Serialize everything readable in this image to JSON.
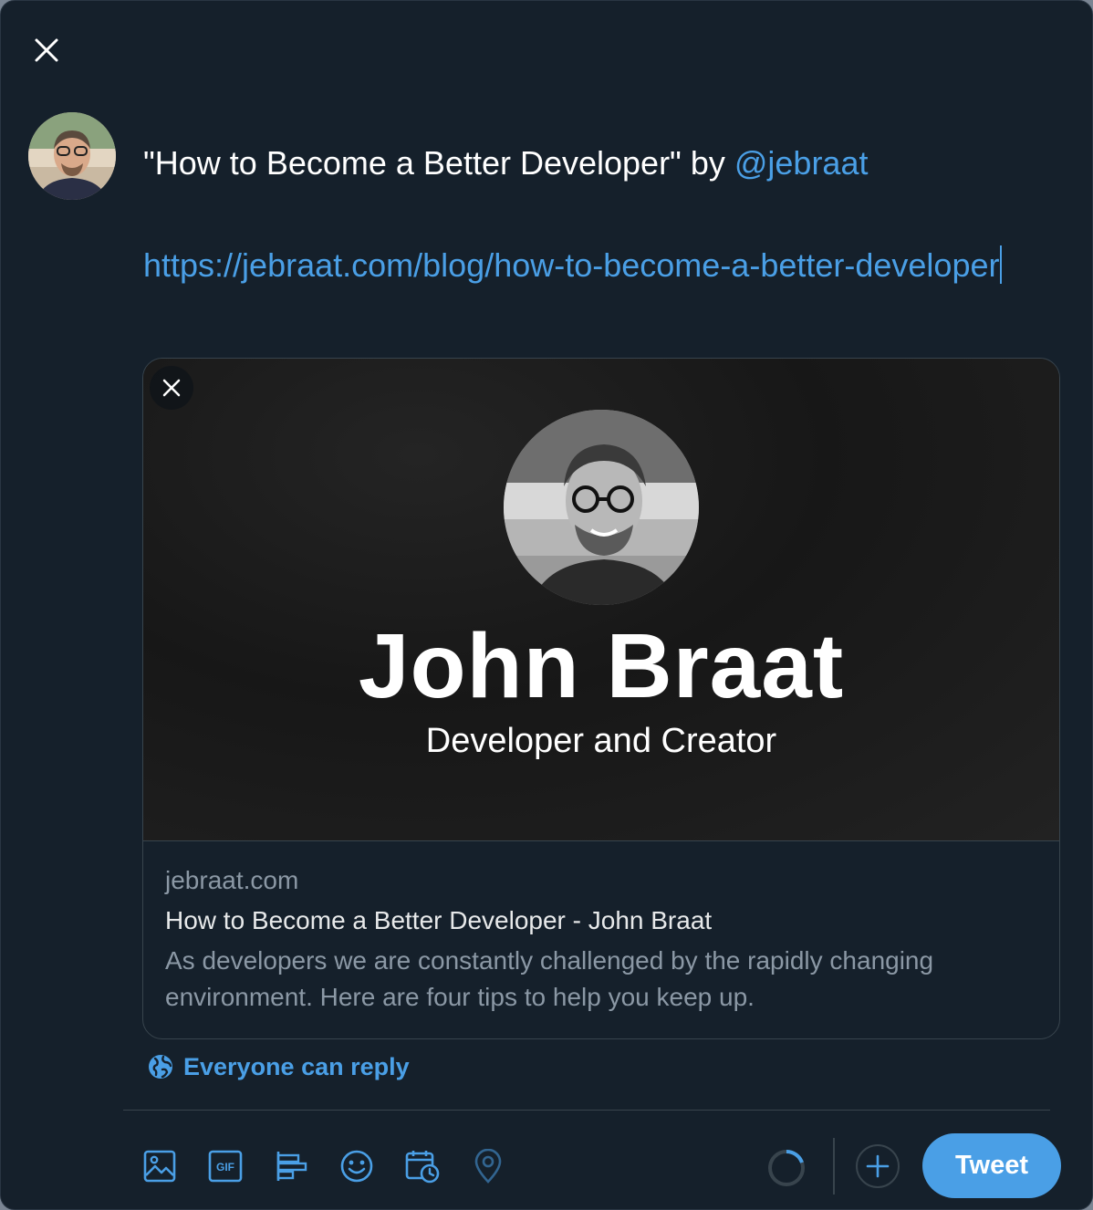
{
  "compose": {
    "text_prefix": "\"How to Become a Better Developer\" by ",
    "mention": "@jebraat",
    "url": "https://jebraat.com/blog/how-to-become-a-better-developer"
  },
  "card": {
    "image_name": "John Braat",
    "image_tagline": "Developer and Creator",
    "domain": "jebraat.com",
    "title": "How to Become a Better Developer - John Braat",
    "description": "As developers we are constantly challenged by the rapidly changing environment. Here are four tips to help you keep up."
  },
  "reply_setting": {
    "label": "Everyone can reply"
  },
  "toolbar": {
    "icons": [
      "image-icon",
      "gif-icon",
      "poll-icon",
      "emoji-icon",
      "schedule-icon",
      "location-icon"
    ],
    "gif_label": "GIF",
    "tweet_label": "Tweet"
  },
  "colors": {
    "background": "#15202b",
    "accent": "#4a9fe6",
    "border": "#38444d",
    "secondary_text": "#8b98a5"
  }
}
